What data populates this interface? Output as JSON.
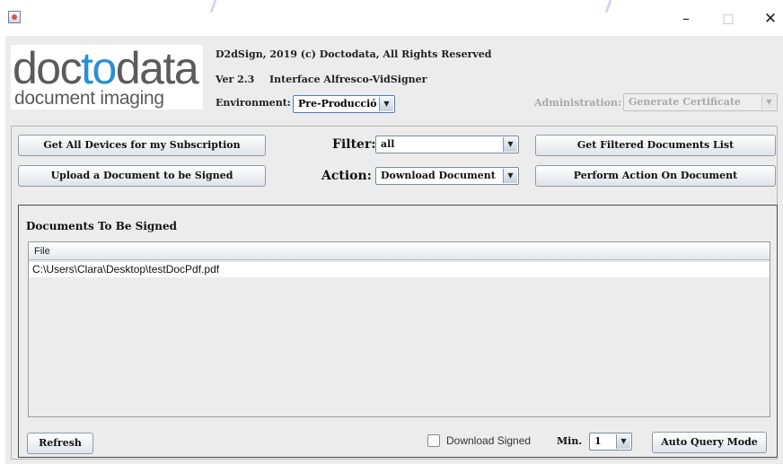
{
  "window": {
    "minimize_glyph": "–",
    "maximize_glyph": "□",
    "close_glyph": "✕",
    "app_icon": "java-cup-icon"
  },
  "logo": {
    "part1": "doc",
    "part2": "to",
    "part3": "data",
    "subtitle": "document imaging",
    "colors": {
      "gray": "#5b5b5b",
      "blue": "#2b8fd4"
    }
  },
  "header": {
    "copyright": "D2dSign, 2019 (c) Doctodata, All Rights Reserved",
    "version": "Ver 2.3",
    "interface": "Interface Alfresco-VidSigner",
    "environment_label": "Environment:",
    "environment_value": "Pre-Producció",
    "administration_label": "Administration:",
    "administration_value": "Generate Certificate"
  },
  "actions": {
    "get_all_devices": "Get All Devices for my Subscription",
    "upload_document": "Upload a Document to be Signed",
    "filter_label": "Filter:",
    "filter_value": "all",
    "action_label": "Action:",
    "action_value": "Download Document",
    "get_filtered": "Get Filtered Documents List",
    "perform_action": "Perform Action On Document"
  },
  "documents": {
    "title": "Documents To Be Signed",
    "columns": [
      "File"
    ],
    "rows": [
      "C:\\Users\\Clara\\Desktop\\testDocPdf.pdf"
    ]
  },
  "footer": {
    "refresh": "Refresh",
    "download_signed": "Download Signed",
    "download_signed_checked": false,
    "min_label": "Min.",
    "min_value": "1",
    "auto_query": "Auto Query Mode"
  },
  "combo_arrow": "▼"
}
